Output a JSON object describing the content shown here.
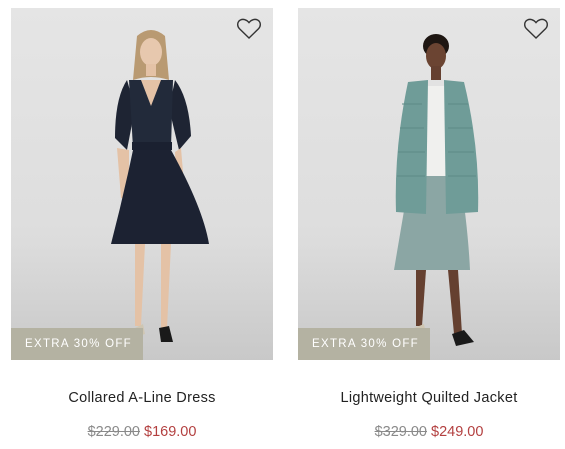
{
  "products": [
    {
      "name": "Collared A-Line Dress",
      "badge": "EXTRA 30% OFF",
      "original_price": "$229.00",
      "sale_price": "$169.00",
      "wishlist_icon": "heart-outline-icon"
    },
    {
      "name": "Lightweight Quilted Jacket",
      "badge": "EXTRA 30% OFF",
      "original_price": "$329.00",
      "sale_price": "$249.00",
      "wishlist_icon": "heart-outline-icon"
    }
  ],
  "colors": {
    "badge_bg": "#b4b2a2",
    "sale_price": "#b34040",
    "original_price": "#8a8a8a"
  }
}
